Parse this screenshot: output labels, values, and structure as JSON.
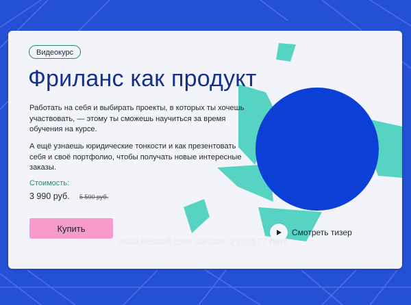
{
  "card": {
    "badge": "Видеокурс",
    "title": "Фриланс как продукт",
    "paragraph_1": "Работать на себя и выбирать проекты, в которых ты хочешь участвовать, — этому ты сможешь научиться за время обучения на курсе.",
    "paragraph_2": "А ещё узнаешь юридические тонкости и как презентовать себя и своё портфолио, чтобы получать новые интересные заказы.",
    "price_label": "Стоимость:",
    "price_current": "3 990 руб.",
    "price_old": "5 500 руб.",
    "buy_label": "Купить",
    "teaser_label": "Смотреть тизер",
    "play_icon": "play-icon"
  },
  "watermark": "www.kidstaff.com.ua/user-2122577.html",
  "colors": {
    "background": "#2450d6",
    "card": "#f3f4fa",
    "title": "#16318c",
    "accent_teal": "#57d3c3",
    "circle_blue": "#0b3fd6",
    "button_pink": "#f59ccd",
    "price_label": "#2a8a6a"
  }
}
